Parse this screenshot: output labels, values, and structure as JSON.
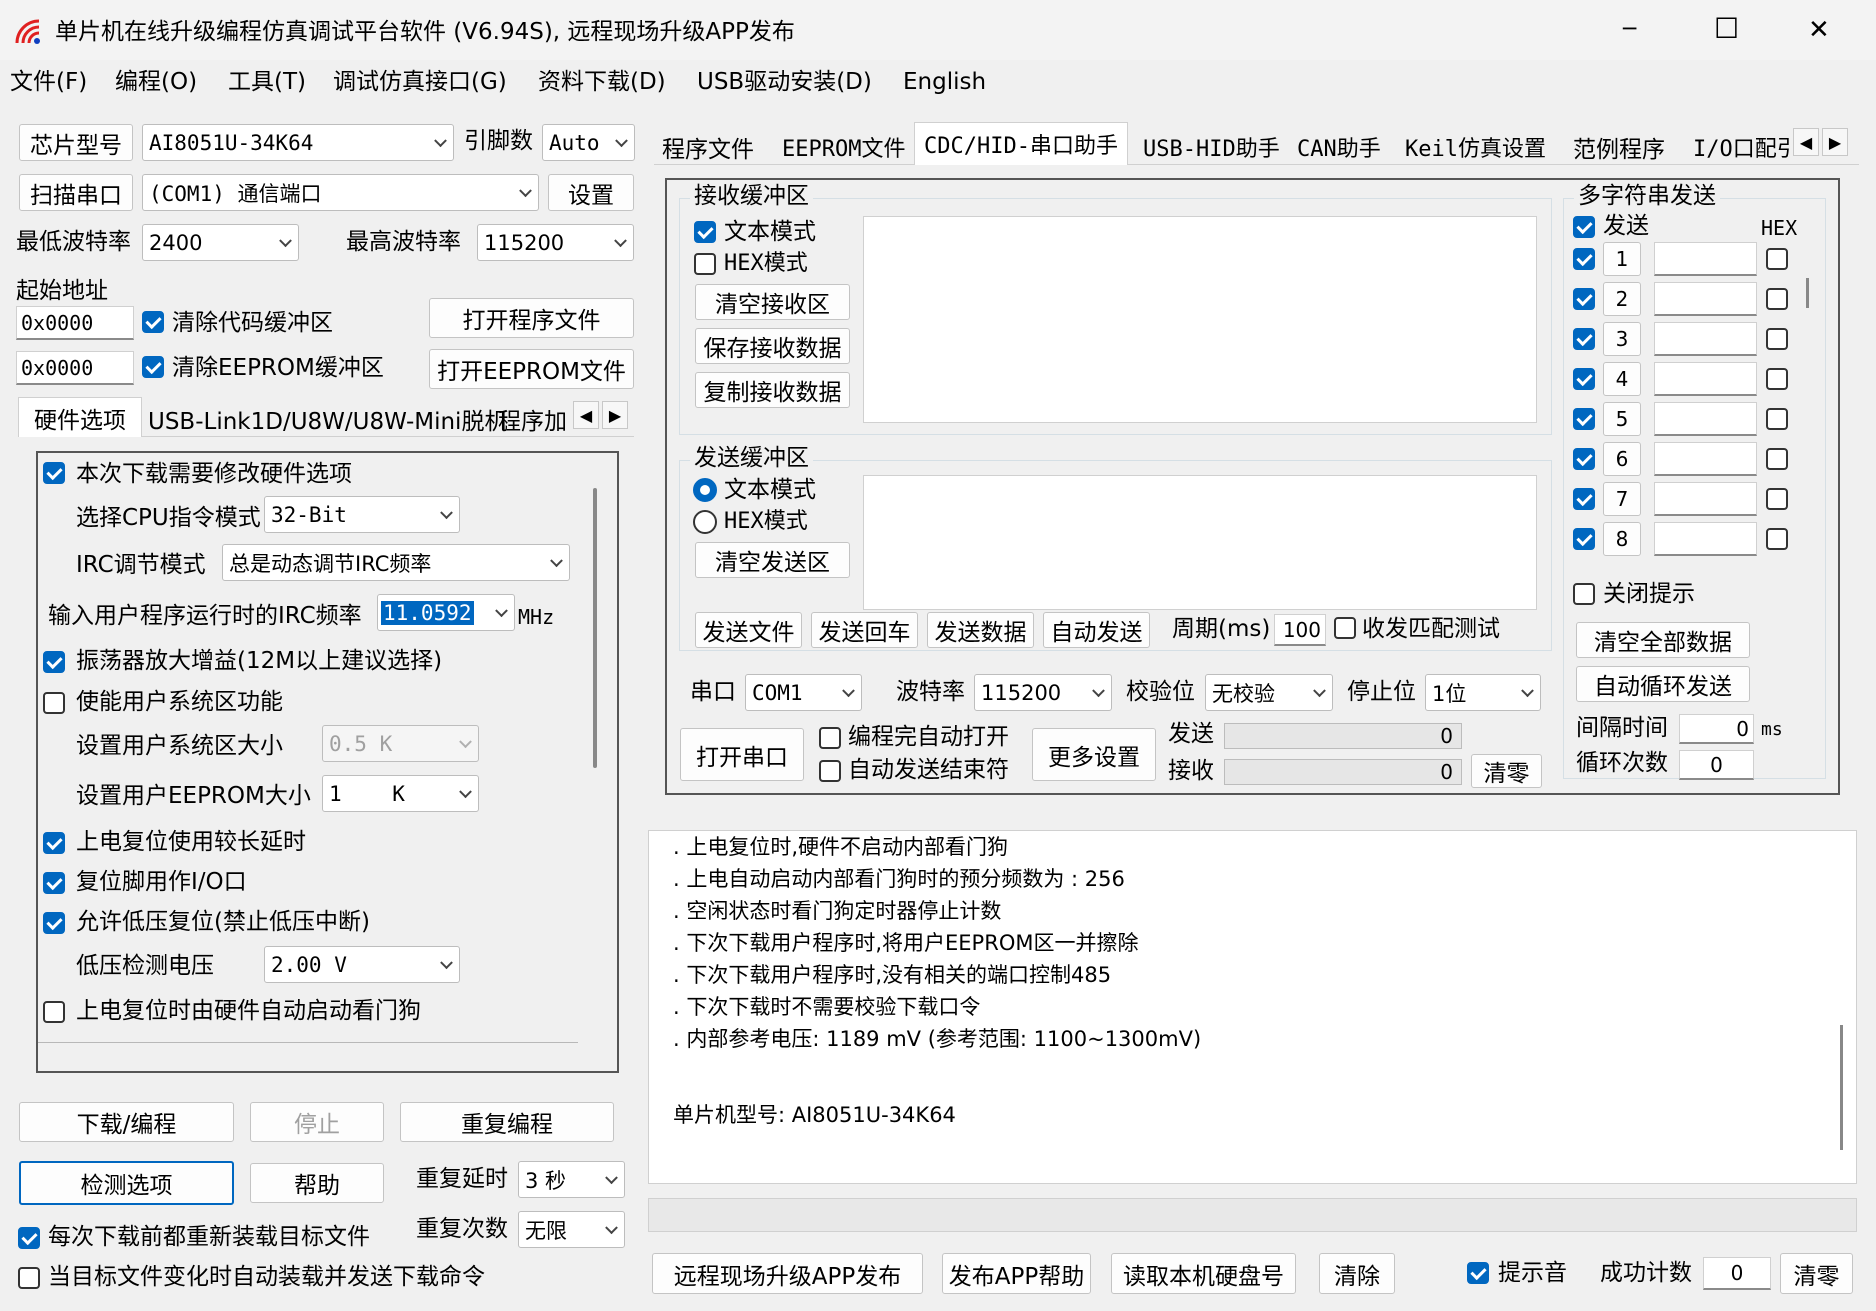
{
  "window": {
    "title": "单片机在线升级编程仿真调试平台软件 (V6.94S), 远程现场升级APP发布",
    "controls": {
      "minimize": "─",
      "maximize": "☐",
      "close": "✕"
    }
  },
  "menu": [
    "文件(F)",
    "编程(O)",
    "工具(T)",
    "调试仿真接口(G)",
    "资料下载(D)",
    "USB驱动安装(D)",
    "English"
  ],
  "left": {
    "chip_label": "芯片型号",
    "chip_value": "AI8051U-34K64",
    "pins_label": "引脚数",
    "pins_value": "Auto",
    "scan_button": "扫描串口",
    "port_value": "(COM1) 通信端口",
    "settings_button": "设置",
    "min_baud_label": "最低波特率",
    "min_baud_value": "2400",
    "max_baud_label": "最高波特率",
    "max_baud_value": "115200",
    "start_addr_label": "起始地址",
    "addr1": "0x0000",
    "clear_code_label": "清除代码缓冲区",
    "open_program_button": "打开程序文件",
    "addr2": "0x0000",
    "clear_eeprom_label": "清除EEPROM缓冲区",
    "open_eeprom_button": "打开EEPROM文件",
    "tabs": [
      "硬件选项",
      "USB-Link1D/U8W/U8W-Mini脱机",
      "程序加"
    ],
    "hw": {
      "modify_label": "本次下载需要修改硬件选项",
      "cpu_mode_label": "选择CPU指令模式",
      "cpu_mode_value": "32-Bit",
      "irc_mode_label": "IRC调节模式",
      "irc_mode_value": "总是动态调节IRC频率",
      "irc_freq_label": "输入用户程序运行时的IRC频率",
      "irc_freq_value": "11.0592",
      "irc_freq_unit": "MHz",
      "osc_gain_label": "振荡器放大增益(12M以上建议选择)",
      "user_sys_label": "使能用户系统区功能",
      "sys_size_label": "设置用户系统区大小",
      "sys_size_value": "0.5 K",
      "eeprom_size_label": "设置用户EEPROM大小",
      "eeprom_size_value": "1    K",
      "long_delay_label": "上电复位使用较长延时",
      "reset_io_label": "复位脚用作I/O口",
      "lvr_label": "允许低压复位(禁止低压中断)",
      "lvd_label": "低压检测电压",
      "lvd_value": "2.00 V",
      "wdt_label": "上电复位时由硬件自动启动看门狗"
    },
    "download_button": "下载/编程",
    "stop_button": "停止",
    "repeat_button": "重复编程",
    "detect_button": "检测选项",
    "help_button": "帮助",
    "repeat_delay_label": "重复延时",
    "repeat_delay_value": "3 秒",
    "repeat_count_label": "重复次数",
    "repeat_count_value": "无限",
    "reload_label": "每次下载前都重新装载目标文件",
    "auto_send_label": "当目标文件变化时自动装载并发送下载命令"
  },
  "right": {
    "tabs": [
      "程序文件",
      "EEPROM文件",
      "CDC/HID-串口助手",
      "USB-HID助手",
      "CAN助手",
      "Keil仿真设置",
      "范例程序",
      "I/O口配引"
    ],
    "recv": {
      "title": "接收缓冲区",
      "text_mode": "文本模式",
      "hex_mode": "HEX模式",
      "clear": "清空接收区",
      "save": "保存接收数据",
      "copy": "复制接收数据"
    },
    "send": {
      "title": "发送缓冲区",
      "text_mode": "文本模式",
      "hex_mode": "HEX模式",
      "clear": "清空发送区"
    },
    "send_file": "发送文件",
    "send_cr": "发送回车",
    "send_data": "发送数据",
    "auto_send": "自动发送",
    "period_label": "周期(ms)",
    "period_value": "100",
    "match_test": "收发匹配测试",
    "port_label": "串口",
    "port_value": "COM1",
    "baud_label": "波特率",
    "baud_value": "115200",
    "parity_label": "校验位",
    "parity_value": "无校验",
    "stop_label": "停止位",
    "stop_value": "1位",
    "open_port": "打开串口",
    "auto_open": "编程完自动打开",
    "auto_end": "自动发送结束符",
    "more_settings": "更多设置",
    "tx_label": "发送",
    "tx_value": "0",
    "rx_label": "接收",
    "rx_value": "0",
    "zero_button": "清零",
    "multi": {
      "title": "多字符串发送",
      "send_header": "发送",
      "hex_header": "HEX",
      "rows": [
        "1",
        "2",
        "3",
        "4",
        "5",
        "6",
        "7",
        "8"
      ],
      "close_tip": "关闭提示",
      "clear_all": "清空全部数据",
      "auto_loop": "自动循环发送",
      "interval_label": "间隔时间",
      "interval_value": "0",
      "interval_unit": "ms",
      "loop_label": "循环次数",
      "loop_value": "0"
    }
  },
  "log": [
    ". 上电复位时,硬件不启动内部看门狗",
    ". 上电自动启动内部看门狗时的预分频数为 : 256",
    ". 空闲状态时看门狗定时器停止计数",
    ". 下次下载用户程序时,将用户EEPROM区一并擦除",
    ". 下次下载用户程序时,没有相关的端口控制485",
    ". 下次下载时不需要校验下载口令",
    ". 内部参考电压: 1189 mV (参考范围: 1100~1300mV)",
    "",
    "单片机型号: AI8051U-34K64"
  ],
  "bottom": {
    "publish": "远程现场升级APP发布",
    "publish_help": "发布APP帮助",
    "read_disk": "读取本机硬盘号",
    "clear": "清除",
    "beep": "提示音",
    "success_label": "成功计数",
    "success_value": "0",
    "zero": "清零"
  },
  "colors": {
    "accent": "#0067c0",
    "background": "#f0f0f0"
  }
}
